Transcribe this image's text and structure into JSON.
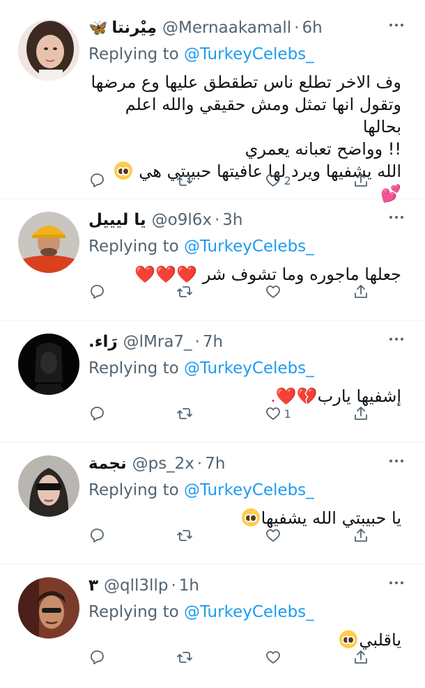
{
  "replying_label": "Replying to",
  "replying_mention": "@TurkeyCelebs_",
  "tweets": [
    {
      "name": "مِيْرنتا",
      "name_emoji": "🦋",
      "handle": "@Mernaakamall",
      "time": "6h",
      "lines": [
        "وف الاخر تطلع ناس تطقطق عليها وع مرضها",
        "وتقول انها تمثل ومش حقيقي والله اعلم بحالها",
        "!!  وواضح تعبانه يعمري",
        "الله يشفيها ويرد لها عافيتها حبيبتي هي"
      ],
      "line_suffix": "💕",
      "likes": "2"
    },
    {
      "name": "يا ليييل",
      "handle": "@o9l6x",
      "time": "3h",
      "lines": [
        "جعلها ماجوره وما تشوف شر"
      ],
      "line_suffix": "❤️❤️❤️",
      "likes": ""
    },
    {
      "name": "رَاء.",
      "handle": "@lMra7_",
      "time": "7h",
      "lines": [
        "إشفيها يارب"
      ],
      "line_suffix": "💔❤️.",
      "likes": "1"
    },
    {
      "name": "نجمة",
      "handle": "@ps_2x",
      "time": "7h",
      "lines": [
        "يا حبيبتي الله يشفيها"
      ],
      "line_suffix": "",
      "likes": ""
    },
    {
      "name": "٣",
      "handle": "@qll3llp",
      "time": "1h",
      "lines": [
        "ياقلبي"
      ],
      "line_suffix": "",
      "likes": ""
    }
  ],
  "icons": {
    "reply": "reply-icon",
    "retweet": "retweet-icon",
    "like": "like-icon",
    "share": "share-icon",
    "more": "more-icon"
  },
  "colors": {
    "link": "#1d9bf0",
    "secondary": "#536471",
    "divider": "#eff3f4"
  }
}
